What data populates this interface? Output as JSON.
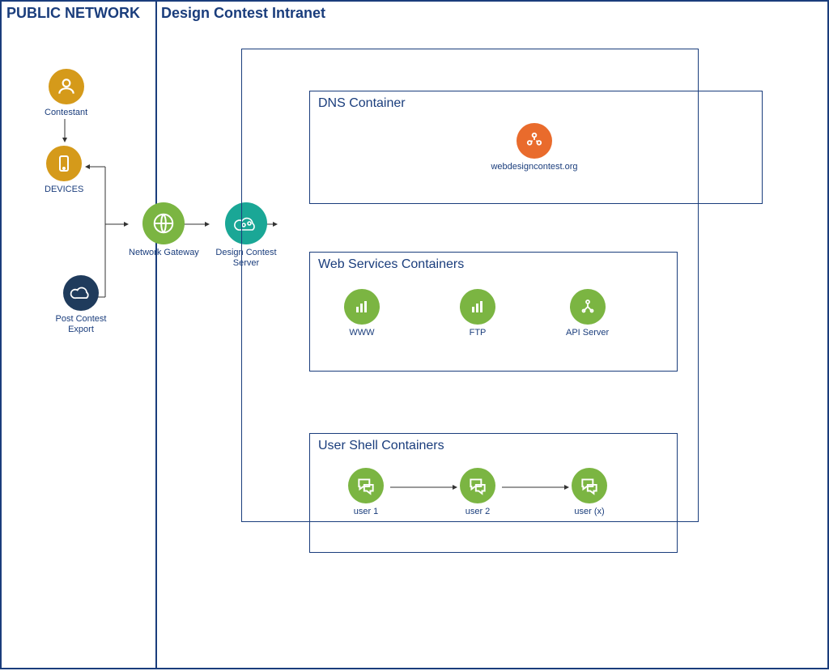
{
  "colors": {
    "border": "#1a3d7c",
    "gold": "#d59a1a",
    "green": "#7bb542",
    "teal": "#1aa796",
    "navy": "#1f3b5c",
    "orange": "#e96b2c"
  },
  "zones": {
    "public": {
      "title": "PUBLIC NETWORK"
    },
    "intranet": {
      "title": "Design Contest Intranet"
    }
  },
  "public_nodes": {
    "contestant": {
      "label": "Contestant",
      "icon": "user",
      "color": "gold"
    },
    "devices": {
      "label": "DEVICES",
      "icon": "device",
      "color": "gold"
    },
    "post_export": {
      "label": "Post Contest Export",
      "icon": "cloud",
      "color": "navy"
    }
  },
  "bridge_nodes": {
    "gateway": {
      "label": "Network Gateway",
      "icon": "globe",
      "color": "green"
    },
    "server": {
      "label": "Design Contest Server",
      "icon": "cloud-gears",
      "color": "teal"
    }
  },
  "server_box": {
    "title": ""
  },
  "dns": {
    "title": "DNS Container",
    "node": {
      "label": "webdesigncontest.org",
      "icon": "group",
      "color": "orange"
    }
  },
  "web_services": {
    "title": "Web Services Containers",
    "nodes": [
      {
        "label": "WWW",
        "icon": "bars",
        "color": "green"
      },
      {
        "label": "FTP",
        "icon": "bars",
        "color": "green"
      },
      {
        "label": "API Server",
        "icon": "api",
        "color": "green"
      }
    ]
  },
  "user_shell": {
    "title": "User Shell Containers",
    "nodes": [
      {
        "label": "user 1",
        "icon": "chat",
        "color": "green"
      },
      {
        "label": "user 2",
        "icon": "chat",
        "color": "green"
      },
      {
        "label": "user (x)",
        "icon": "chat",
        "color": "green"
      }
    ]
  }
}
